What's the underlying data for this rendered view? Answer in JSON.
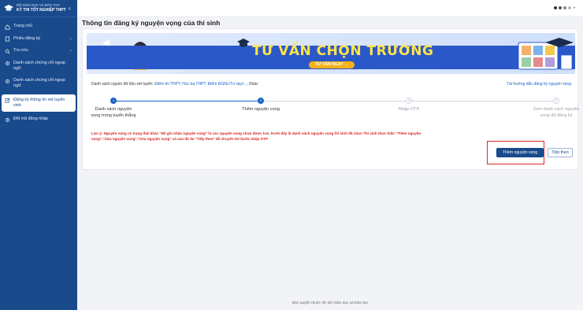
{
  "brand": {
    "line1": "BỘ GIÁO DỤC VÀ ĐÀO TẠO",
    "line2": "KỲ THI TỐT NGHIỆP THPT",
    "collapse_icon": "chevron-left-icon"
  },
  "sidebar": {
    "items": [
      {
        "label": "Trang chủ",
        "icon": "home-icon"
      },
      {
        "label": "Phiếu đăng ký",
        "icon": "document-icon",
        "has_children": true
      },
      {
        "label": "Tra cứu",
        "icon": "search-icon",
        "has_children": true
      },
      {
        "label": "Danh sách chứng chỉ ngoại ngữ",
        "icon": "gear-icon"
      },
      {
        "label": "Danh sách chứng chỉ ngoại ngữ",
        "icon": "gear-icon"
      },
      {
        "label": "Đăng ký thông tin xét tuyển sinh",
        "icon": "edit-icon",
        "active": true
      },
      {
        "label": "Đổi mã đăng nhập",
        "icon": "gear-icon"
      }
    ]
  },
  "page": {
    "title": "Thông tin đăng ký nguyện vọng của thí sinh"
  },
  "banner": {
    "headline": "TƯ VẤN CHỌN TRƯỜNG",
    "button": "TƯ VẤN NGAY →",
    "colors": {
      "band": "#2b58c8",
      "headline": "#ffe44a",
      "button": "#f3b218"
    }
  },
  "info": {
    "prefix": "Danh sách nguồn dữ liệu xét tuyển:",
    "links": "Điểm thi THPT; Học bạ THPT; Điểm ĐGNL/Tư duy/...;",
    "suffix": "Khác",
    "guide": "Tải hướng dẫn đăng ký nguyện vọng"
  },
  "steps": [
    {
      "number": "1",
      "label": "Danh sách nguyện vọng trúng tuyển thẳng",
      "status": "done"
    },
    {
      "number": "2",
      "label": "Thêm nguyện vọng",
      "status": "current"
    },
    {
      "number": "3",
      "label": "Nhập OTP",
      "status": "todo"
    },
    {
      "number": "4",
      "label": "Xem danh sách nguyện vọng đã đăng ký",
      "status": "todo"
    }
  ],
  "warning": "Lưu ý: Nguyện vọng có trạng thái khác \"Đã ghi nhận nguyện vọng\" là các nguyện vọng chưa được lưu. Dưới đây là danh sách nguyện vọng thí sinh đã chọn Thí sinh thực hiện \"Thêm nguyện vọng\",\"Sửa nguyện vọng\",\"Xóa nguyện vọng\" và sau đó ấn \"Tiếp theo\" để chuyển tới bước nhập OTP",
  "actions": {
    "add": "Thêm nguyện vọng",
    "next": "Tiếp theo"
  },
  "footer": "Bản quyền thuộc về: Bộ Giáo dục và Đào tạo",
  "colors": {
    "sidebar": "#184a8c",
    "accent": "#1a63c9",
    "warning": "#d42323",
    "highlight": "#e3242b"
  }
}
